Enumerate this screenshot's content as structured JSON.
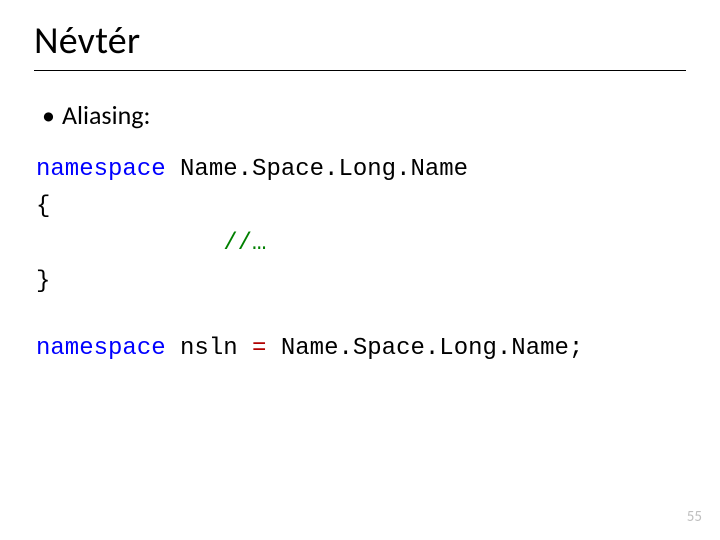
{
  "title": "Névtér",
  "bullet": {
    "marker": "•",
    "text": "Aliasing:"
  },
  "code1": {
    "kw1": "namespace",
    "ns_name": "Name.Space.Long.Name",
    "open": "{",
    "comment": "//…",
    "close": "}"
  },
  "code2": {
    "kw1": "namespace",
    "alias": "nsln",
    "eq": "=",
    "ns_name": "Name.Space.Long.Name",
    "semi": ";"
  },
  "page_number": "55"
}
